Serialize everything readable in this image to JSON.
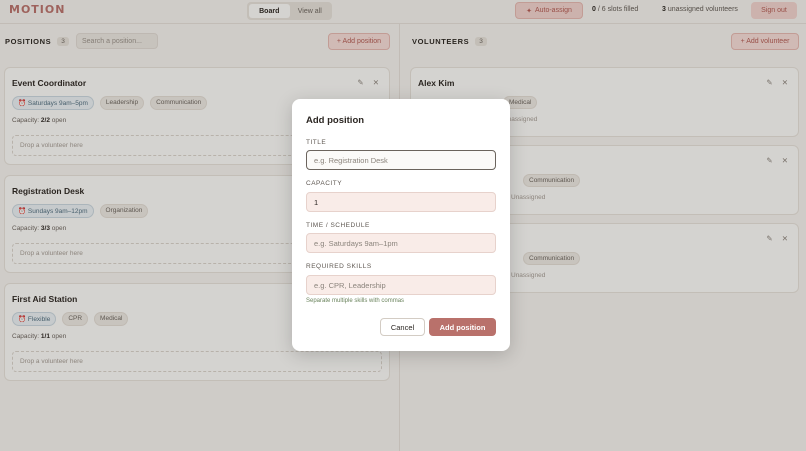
{
  "app": {
    "logo": "MOTION"
  },
  "header": {
    "tabs": [
      {
        "label": "Board",
        "active": true
      },
      {
        "label": "View all",
        "active": false
      }
    ],
    "auto_assign": "Auto-assign",
    "slots_filled_num": "0",
    "slots_filled_text": "/ 6 slots filled",
    "unassigned_num": "3",
    "unassigned_text": "unassigned volunteers",
    "sign_out": "Sign out"
  },
  "positions": {
    "title": "POSITIONS",
    "count": "3",
    "search_placeholder": "Search a position...",
    "add_label": "+ Add position",
    "cards": [
      {
        "title": "Event Coordinator",
        "time": "Saturdays 9am–5pm",
        "skills": [
          "Leadership",
          "Communication"
        ],
        "capacity_label": "Capacity:",
        "capacity_value": "2/2",
        "capacity_suffix": "open",
        "drop": "Drop a volunteer here"
      },
      {
        "title": "Registration Desk",
        "time": "Sundays 9am–12pm",
        "skills": [
          "Organization"
        ],
        "capacity_label": "Capacity:",
        "capacity_value": "3/3",
        "capacity_suffix": "open",
        "drop": "Drop a volunteer here"
      },
      {
        "title": "First Aid Station",
        "time": "Flexible",
        "skills": [
          "CPR",
          "Medical"
        ],
        "capacity_label": "Capacity:",
        "capacity_value": "1/1",
        "capacity_suffix": "open",
        "drop": "Drop a volunteer here"
      }
    ]
  },
  "volunteers": {
    "title": "VOLUNTEERS",
    "count": "3",
    "add_label": "+ Add volunteer",
    "cards": [
      {
        "title": "Alex Kim",
        "chips": [
          "Medical"
        ],
        "status": "Unassigned"
      },
      {
        "title": "",
        "chips": [
          "Communication"
        ],
        "status": "Unassigned"
      },
      {
        "title": "",
        "chips": [
          "Communication"
        ],
        "status": "Unassigned"
      }
    ]
  },
  "modal": {
    "title": "Add position",
    "title_label": "TITLE",
    "title_placeholder": "e.g. Registration Desk",
    "capacity_label": "CAPACITY",
    "capacity_value": "1",
    "time_label": "TIME / SCHEDULE",
    "time_placeholder": "e.g. Saturdays 9am–1pm",
    "skills_label": "REQUIRED SKILLS",
    "skills_placeholder": "e.g. CPR, Leadership",
    "hint": "Separate multiple skills with commas",
    "cancel": "Cancel",
    "submit": "Add position"
  },
  "colors": {
    "accent": "#b9716b",
    "background": "#f4f2ee",
    "overlay": "rgba(40,34,30,0.18)"
  }
}
